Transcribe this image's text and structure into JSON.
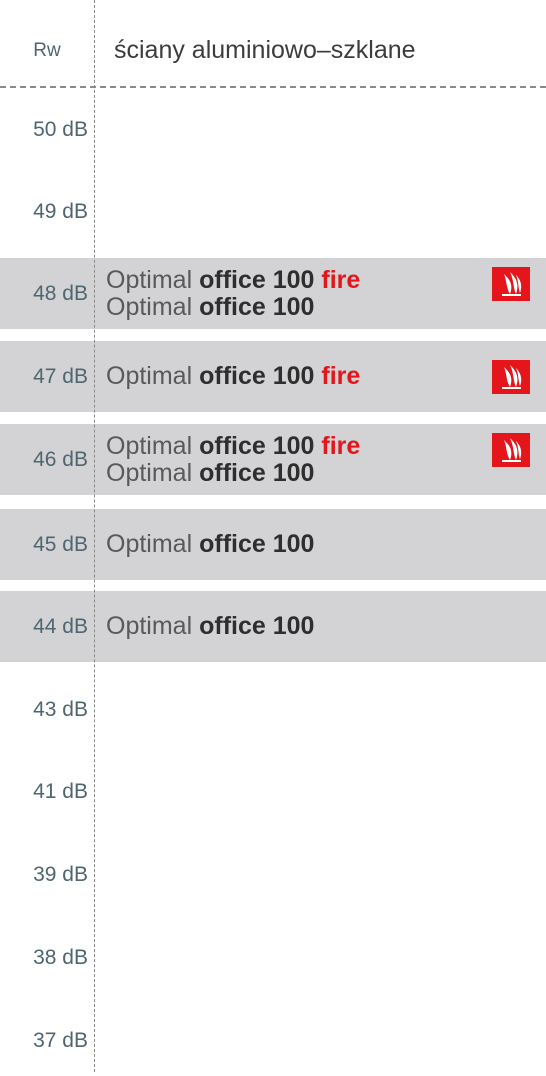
{
  "header": {
    "rw_label": "Rw",
    "column_title": "ściany aluminiowo–szklane"
  },
  "rows": [
    {
      "db": "50 dB",
      "products": []
    },
    {
      "db": "49 dB",
      "products": []
    },
    {
      "db": "48 dB",
      "products": [
        {
          "prefix": "Optimal",
          "name": "office 100",
          "suffix": "fire"
        },
        {
          "prefix": "Optimal",
          "name": "office 100",
          "suffix": ""
        }
      ],
      "fire_icon": "flame-icon"
    },
    {
      "db": "47 dB",
      "products": [
        {
          "prefix": "Optimal",
          "name": "office 100",
          "suffix": "fire"
        }
      ],
      "fire_icon": "flame-icon"
    },
    {
      "db": "46 dB",
      "products": [
        {
          "prefix": "Optimal",
          "name": "office 100",
          "suffix": "fire"
        },
        {
          "prefix": "Optimal",
          "name": "office 100",
          "suffix": ""
        }
      ],
      "fire_icon": "flame-icon"
    },
    {
      "db": "45 dB",
      "products": [
        {
          "prefix": "Optimal",
          "name": "office 100",
          "suffix": ""
        }
      ]
    },
    {
      "db": "44 dB",
      "products": [
        {
          "prefix": "Optimal",
          "name": "office 100",
          "suffix": ""
        }
      ]
    },
    {
      "db": "43 dB",
      "products": []
    },
    {
      "db": "41 dB",
      "products": []
    },
    {
      "db": "39 dB",
      "products": []
    },
    {
      "db": "38 dB",
      "products": []
    },
    {
      "db": "37 dB",
      "products": []
    }
  ],
  "colors": {
    "row_fill": "#d3d3d6",
    "fire_red": "#e3171b",
    "db_text": "#4f6570"
  }
}
